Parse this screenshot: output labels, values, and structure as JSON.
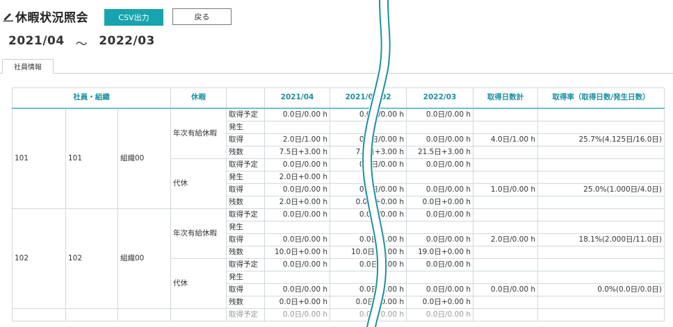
{
  "header": {
    "title": "休暇状況照会",
    "csv_label": "CSV出力",
    "back_label": "戻る"
  },
  "period": {
    "from": "2021/04",
    "sep": "～",
    "to": "2022/03"
  },
  "tabs": [
    {
      "label": "社員情報"
    }
  ],
  "table": {
    "headers": [
      "社員・組織",
      "休暇",
      "2021/04",
      "2021/05/02",
      "2022/03",
      "取得日数計",
      "取得率（取得日数/発生日数）"
    ],
    "employees": [
      {
        "emp_no": "101",
        "emp_code": "101",
        "org": "組織00",
        "leaves": [
          {
            "type": "年次有給休暇",
            "rows": [
              {
                "label": "取得予定",
                "m1": "0.0日/0.00 h",
                "m2": "0.0日/0.00 h",
                "m3": "0.0日/0.00 h",
                "total": "",
                "rate": ""
              },
              {
                "label": "発生",
                "m1": "",
                "m2": "",
                "m3": "",
                "total": "",
                "rate": ""
              },
              {
                "label": "取得",
                "m1": "2.0日/1.00 h",
                "m2": "0.0日/0.00 h",
                "m3": "0.0日/0.00 h",
                "total": "4.0日/1.00 h",
                "rate": "25.7%(4.125日/16.0日)"
              },
              {
                "label": "残数",
                "m1": "7.5日+3.00 h",
                "m2": "7.5日+3.00 h",
                "m3": "21.5日+3.00 h",
                "total": "",
                "rate": ""
              }
            ]
          },
          {
            "type": "代休",
            "rows": [
              {
                "label": "取得予定",
                "m1": "0.0日/0.00 h",
                "m2": "0.0日/0.00 h",
                "m3": "0.0日/0.00 h",
                "total": "",
                "rate": ""
              },
              {
                "label": "発生",
                "m1": "2.0日+0.00 h",
                "m2": "",
                "m3": "",
                "total": "",
                "rate": ""
              },
              {
                "label": "取得",
                "m1": "0.0日/0.00 h",
                "m2": "0.0日/0.00 h",
                "m3": "0.0日/0.00 h",
                "total": "1.0日/0.00 h",
                "rate": "25.0%(1.000日/4.0日)"
              },
              {
                "label": "残数",
                "m1": "2.0日+0.00 h",
                "m2": "0.0日+0.00 h",
                "m3": "0.0日+0.00 h",
                "total": "",
                "rate": ""
              }
            ]
          }
        ]
      },
      {
        "emp_no": "102",
        "emp_code": "102",
        "org": "組織00",
        "leaves": [
          {
            "type": "年次有給休暇",
            "rows": [
              {
                "label": "取得予定",
                "m1": "0.0日/0.00 h",
                "m2": "0.0日/0.00 h",
                "m3": "0.0日/0.00 h",
                "total": "",
                "rate": ""
              },
              {
                "label": "発生",
                "m1": "",
                "m2": "",
                "m3": "",
                "total": "",
                "rate": ""
              },
              {
                "label": "取得",
                "m1": "0.0日/0.00 h",
                "m2": "0.0日/0.00 h",
                "m3": "0.0日/0.00 h",
                "total": "2.0日/0.00 h",
                "rate": "18.1%(2.000日/11.0日)"
              },
              {
                "label": "残数",
                "m1": "10.0日+0.00 h",
                "m2": "10.0日+0.00 h",
                "m3": "19.0日+0.00 h",
                "total": "",
                "rate": ""
              }
            ]
          },
          {
            "type": "代休",
            "rows": [
              {
                "label": "取得予定",
                "m1": "0.0日/0.00 h",
                "m2": "0.0日/0.00 h",
                "m3": "0.0日/0.00 h",
                "total": "",
                "rate": ""
              },
              {
                "label": "発生",
                "m1": "",
                "m2": "",
                "m3": "",
                "total": "",
                "rate": ""
              },
              {
                "label": "取得",
                "m1": "0.0日/0.00 h",
                "m2": "0.0日/0.00 h",
                "m3": "0.0日/0.00 h",
                "total": "0.0日/0.00 h",
                "rate": "0.0%(0.0日/0.0日)"
              },
              {
                "label": "残数",
                "m1": "0.0日+0.00 h",
                "m2": "0.0日+0.00 h",
                "m3": "0.0日+0.00 h",
                "total": "",
                "rate": ""
              }
            ]
          }
        ]
      }
    ],
    "partial_row": {
      "label": "取得予定",
      "m1": "0.0日/0.00 h",
      "m2": "0.0日/0.00 h",
      "m3": "0.0日/0.00 h"
    }
  },
  "colors": {
    "accent": "#17a4ae",
    "header_text": "#1a8fa0",
    "grid": "#cfd8dc",
    "break_line": "#1a8fa0"
  }
}
